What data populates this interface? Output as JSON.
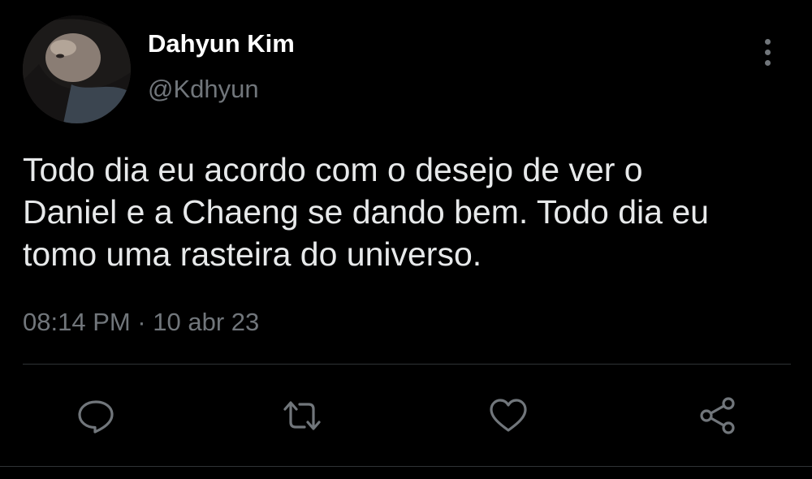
{
  "author": {
    "display_name": "Dahyun Kim",
    "handle": "@Kdhyun"
  },
  "tweet": {
    "text_lines": [
      "Todo dia eu acordo com o desejo de ver o",
      "Daniel e a Chaeng se dando bem. Todo dia eu",
      "tomo uma rasteira do universo."
    ],
    "timestamp": "08:14 PM · 10 abr 23"
  },
  "actions": [
    {
      "name": "reply",
      "icon": "speech-bubble-icon"
    },
    {
      "name": "retweet",
      "icon": "retweet-arrows-icon"
    },
    {
      "name": "like",
      "icon": "heart-icon"
    },
    {
      "name": "share",
      "icon": "share-nodes-icon"
    }
  ],
  "more_menu": {
    "icon": "vertical-ellipsis-icon"
  },
  "colors": {
    "background": "#000000",
    "primary_text": "#e7e9ea",
    "secondary_text": "#71767b",
    "divider": "#2f3336"
  }
}
